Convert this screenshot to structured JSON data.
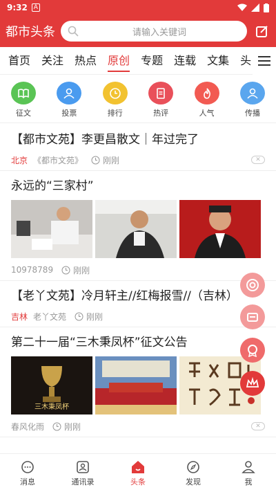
{
  "status": {
    "time": "9:32",
    "notif_icon": "A"
  },
  "header": {
    "brand": "都市头条",
    "search_placeholder": "请输入关键词"
  },
  "tabs": [
    "首页",
    "关注",
    "热点",
    "原创",
    "专题",
    "连载",
    "文集",
    "头"
  ],
  "active_tab": 3,
  "quick": [
    {
      "label": "征文",
      "color": "#5ac455",
      "icon": "book-icon"
    },
    {
      "label": "投票",
      "color": "#4a9bef",
      "icon": "person-icon"
    },
    {
      "label": "排行",
      "color": "#f2c230",
      "icon": "clock-icon"
    },
    {
      "label": "热评",
      "color": "#e9505a",
      "icon": "document-icon"
    },
    {
      "label": "人气",
      "color": "#f25a52",
      "icon": "fire-icon"
    },
    {
      "label": "传播",
      "color": "#5aa6ee",
      "icon": "person-icon"
    }
  ],
  "articles": [
    {
      "title": "【都市文苑】李更昌散文｜年过完了",
      "loc": "北京",
      "source": "《都市文苑》",
      "time": "刚刚"
    },
    {
      "title": "永远的“三家村”",
      "source": "10978789",
      "time": "刚刚"
    },
    {
      "title": "【老丫文苑】冷月轩主//红梅报雪//（吉林）",
      "loc": "吉林",
      "source": "老丫文苑",
      "time": "刚刚"
    },
    {
      "title": "第二十一届“三木秉凤杯”征文公告",
      "source": "春风化雨",
      "time": "刚刚",
      "thumb1_caption": "三木秉凤杯"
    }
  ],
  "bottom_nav": [
    {
      "label": "消息",
      "icon": "message-icon"
    },
    {
      "label": "通讯录",
      "icon": "contacts-icon"
    },
    {
      "label": "头条",
      "icon": "home-icon"
    },
    {
      "label": "发现",
      "icon": "compass-icon"
    },
    {
      "label": "我",
      "icon": "profile-icon"
    }
  ],
  "colors": {
    "brand": "#e23a3a"
  }
}
